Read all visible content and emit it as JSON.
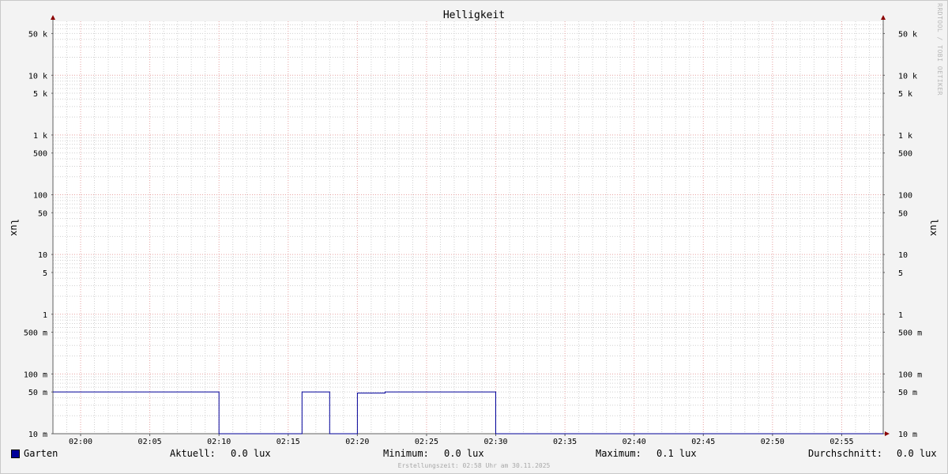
{
  "chart_data": {
    "type": "line",
    "title": "Helligkeit",
    "ylabel_left": "lux",
    "ylabel_right": "lux",
    "y_scale": "log",
    "ylim": [
      0.01,
      80000
    ],
    "y_ticks": [
      {
        "value": 50000,
        "label": "50 k"
      },
      {
        "value": 10000,
        "label": "10 k"
      },
      {
        "value": 5000,
        "label": "5 k"
      },
      {
        "value": 1000,
        "label": "1 k"
      },
      {
        "value": 500,
        "label": "500"
      },
      {
        "value": 100,
        "label": "100"
      },
      {
        "value": 50,
        "label": "50"
      },
      {
        "value": 10,
        "label": "10"
      },
      {
        "value": 5,
        "label": "5"
      },
      {
        "value": 1,
        "label": "1"
      },
      {
        "value": 0.5,
        "label": "500 m"
      },
      {
        "value": 0.1,
        "label": "100 m"
      },
      {
        "value": 0.05,
        "label": "50 m"
      },
      {
        "value": 0.01,
        "label": "10 m"
      }
    ],
    "x_range": [
      "01:58",
      "02:58"
    ],
    "x_ticks": [
      "02:00",
      "02:05",
      "02:10",
      "02:15",
      "02:20",
      "02:25",
      "02:30",
      "02:35",
      "02:40",
      "02:45",
      "02:50",
      "02:55"
    ],
    "grid": true,
    "series": [
      {
        "name": "Garten",
        "color": "#000099",
        "points": [
          [
            "01:58",
            0.05
          ],
          [
            "02:10",
            0.05
          ],
          [
            "02:10",
            0.01
          ],
          [
            "02:16",
            0.01
          ],
          [
            "02:16",
            0.05
          ],
          [
            "02:18",
            0.05
          ],
          [
            "02:18",
            0.01
          ],
          [
            "02:20",
            0.01
          ],
          [
            "02:20",
            0.048
          ],
          [
            "02:22",
            0.048
          ],
          [
            "02:22",
            0.05
          ],
          [
            "02:30",
            0.05
          ],
          [
            "02:30",
            0.01
          ],
          [
            "02:58",
            0.01
          ]
        ]
      }
    ]
  },
  "legend": {
    "series_name": "Garten",
    "series_color": "#000099",
    "current_label": "Aktuell:",
    "current_value": "0.0 lux",
    "min_label": "Minimum:",
    "min_value": "0.0 lux",
    "max_label": "Maximum:",
    "max_value": "0.1 lux",
    "avg_label": "Durchschnitt:",
    "avg_value": "0.0 lux"
  },
  "footer": {
    "creation_time": "Erstellungszeit: 02:58 Uhr am 30.11.2025"
  },
  "credit": "RRDTOOL / TOBI OETIKER",
  "colors": {
    "major_grid": "#e6a0a0",
    "minor_grid": "#cfcfcf",
    "axis": "#606060",
    "arrow": "#8b0000"
  }
}
